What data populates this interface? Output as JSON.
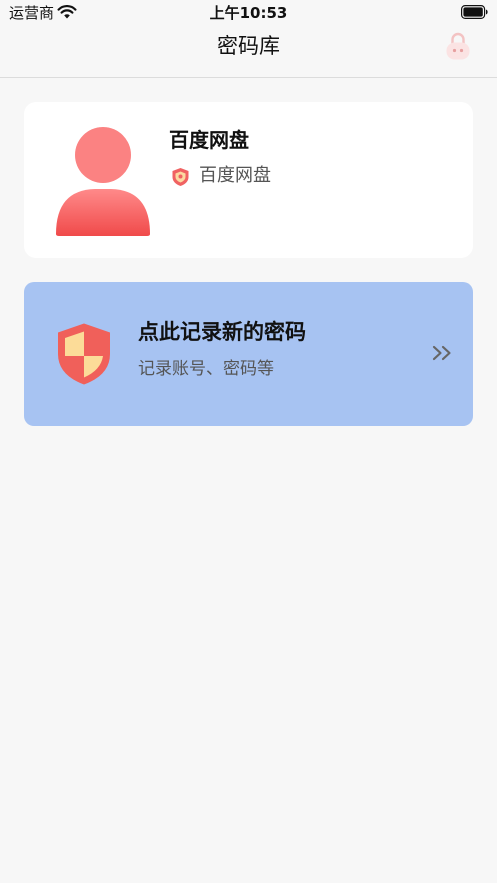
{
  "status_bar": {
    "carrier": "运营商",
    "time": "上午10:53"
  },
  "nav": {
    "title": "密码库"
  },
  "account": {
    "name": "百度网盘",
    "app": "百度网盘"
  },
  "add_entry": {
    "title": "点此记录新的密码",
    "subtitle": "记录账号、密码等"
  },
  "colors": {
    "add_card_bg": "#a7c3f2",
    "avatar_red": "#f05454",
    "shield_red": "#f0605a",
    "shield_yellow": "#fcdc98"
  }
}
